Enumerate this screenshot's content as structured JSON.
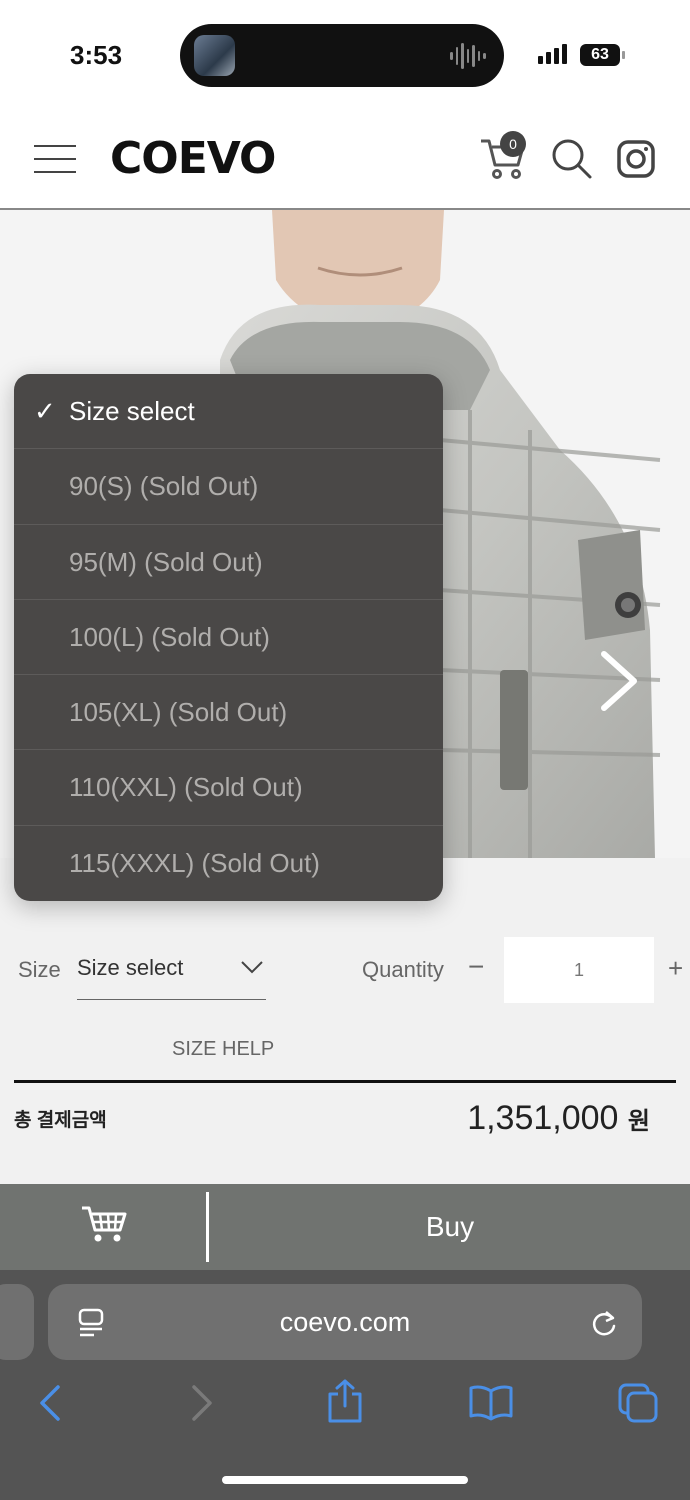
{
  "status_bar": {
    "time": "3:53",
    "battery": "63"
  },
  "header": {
    "logo": "COEVO",
    "cart_count": "0"
  },
  "size_dropdown": {
    "options": [
      {
        "label": "Size select",
        "selected": true
      },
      {
        "label": "90(S) (Sold Out)",
        "selected": false
      },
      {
        "label": "95(M) (Sold Out)",
        "selected": false
      },
      {
        "label": "100(L) (Sold Out)",
        "selected": false
      },
      {
        "label": "105(XL) (Sold Out)",
        "selected": false
      },
      {
        "label": "110(XXL) (Sold Out)",
        "selected": false
      },
      {
        "label": "115(XXXL) (Sold Out)",
        "selected": false
      }
    ]
  },
  "options": {
    "size_label": "Size",
    "size_value": "Size select",
    "quantity_label": "Quantity",
    "quantity_minus": "−",
    "quantity_value": "1",
    "quantity_plus": "+",
    "size_help": "SIZE HELP"
  },
  "total": {
    "label": "총 결제금액",
    "amount": "1,351,000",
    "currency": "원"
  },
  "buy_bar": {
    "buy_label": "Buy"
  },
  "browser": {
    "url": "coevo.com"
  },
  "colors": {
    "dropdown_bg": "#4a4847",
    "buy_bar_bg": "#707370",
    "safari_bg": "#545454",
    "safari_blue": "#4a8fe7"
  }
}
